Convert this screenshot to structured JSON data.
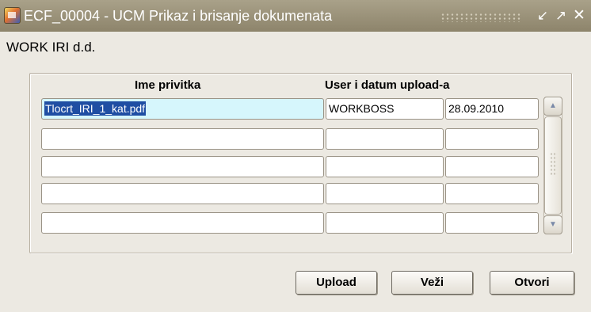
{
  "window": {
    "title": "ECF_00004 - UCM Prikaz i brisanje dokumenata",
    "icon": "oracle-forms-app-icon",
    "controls": {
      "minimize": "↙",
      "maximize": "↗",
      "close": "✕"
    }
  },
  "company": "WORK IRI d.d.",
  "table": {
    "columns": [
      "Ime privitka",
      "User i datum upload-a"
    ],
    "rows": [
      {
        "name": "Tlocrt_IRI_1_kat.pdf",
        "user": "WORKBOSS",
        "date": "28.09.2010"
      },
      {
        "name": "",
        "user": "",
        "date": ""
      },
      {
        "name": "",
        "user": "",
        "date": ""
      },
      {
        "name": "",
        "user": "",
        "date": ""
      },
      {
        "name": "",
        "user": "",
        "date": ""
      }
    ]
  },
  "scrollbar": {
    "up": "▲",
    "down": "▼"
  },
  "buttons": {
    "upload": "Upload",
    "vezi": "Veži",
    "otvori": "Otvori"
  },
  "colors": {
    "titlebar": "#978f74",
    "selection": "#1f4ea3",
    "current_record": "#d6f6fc"
  }
}
